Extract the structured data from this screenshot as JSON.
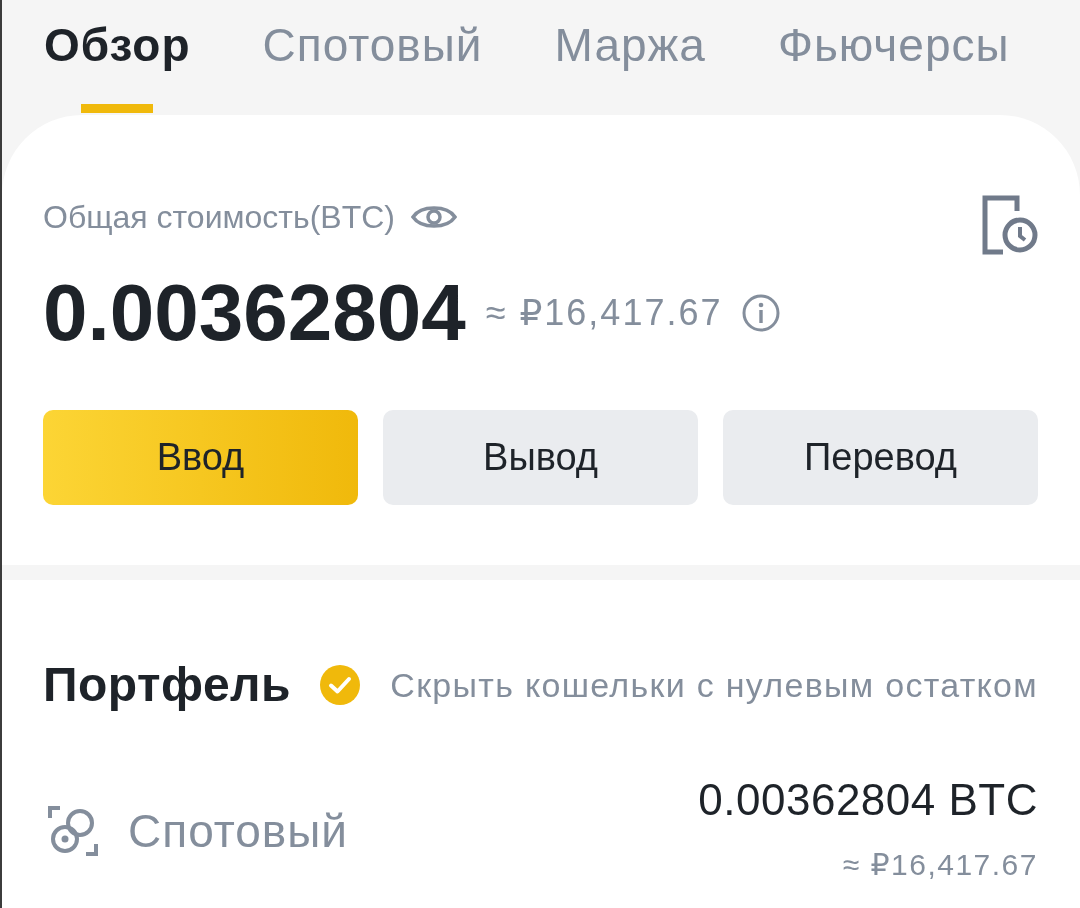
{
  "tabs": [
    {
      "label": "Обзор",
      "selected": true
    },
    {
      "label": "Спотовый",
      "selected": false
    },
    {
      "label": "Маржа",
      "selected": false
    },
    {
      "label": "Фьючерсы",
      "selected": false
    }
  ],
  "overview": {
    "label": "Общая стоимость(BTC)",
    "amount": "0.00362804",
    "approx": "≈ ₽16,417.67"
  },
  "actions": [
    {
      "label": "Ввод",
      "kind": "primary"
    },
    {
      "label": "Вывод",
      "kind": "secondary"
    },
    {
      "label": "Перевод",
      "kind": "secondary"
    }
  ],
  "portfolio": {
    "title": "Портфель",
    "hide_zero_balances": {
      "label": "Скрыть кошельки с нулевым остатком",
      "checked": true
    },
    "wallets": [
      {
        "name": "Спотовый",
        "amount": "0.00362804 BTC",
        "approx": "≈ ₽16,417.67"
      }
    ]
  }
}
